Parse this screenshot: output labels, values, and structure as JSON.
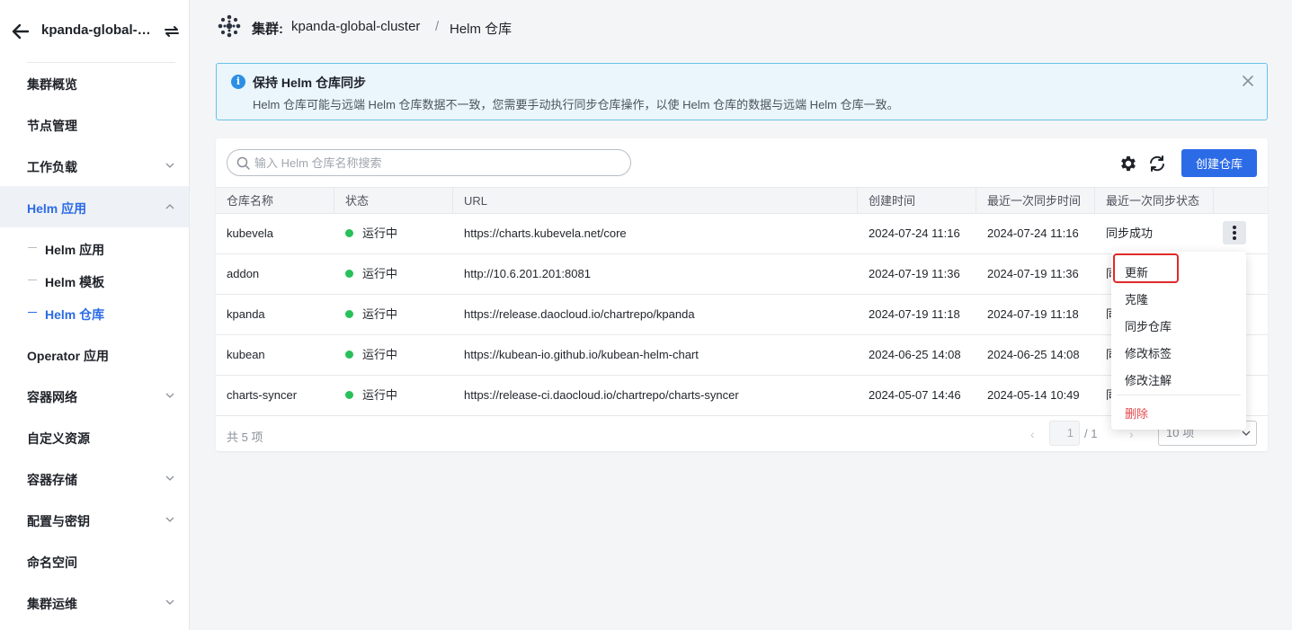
{
  "sidebar": {
    "title": "kpanda-global-cluster",
    "items": [
      {
        "label": "集群概览"
      },
      {
        "label": "节点管理"
      },
      {
        "label": "工作负载"
      },
      {
        "label": "Helm 应用"
      },
      {
        "label": "Operator 应用"
      },
      {
        "label": "容器网络"
      },
      {
        "label": "自定义资源"
      },
      {
        "label": "容器存储"
      },
      {
        "label": "配置与密钥"
      },
      {
        "label": "命名空间"
      },
      {
        "label": "集群运维"
      }
    ],
    "sub_items": [
      {
        "label": "Helm 应用"
      },
      {
        "label": "Helm 模板"
      },
      {
        "label": "Helm 仓库"
      }
    ]
  },
  "breadcrumb": {
    "cluster_label": "集群:",
    "cluster_name": "kpanda-global-cluster",
    "separator": "/",
    "current": "Helm 仓库"
  },
  "alert": {
    "title": "保持 Helm 仓库同步",
    "text": "Helm 仓库可能与远端 Helm 仓库数据不一致，您需要手动执行同步仓库操作，以使 Helm 仓库的数据与远端 Helm 仓库一致。"
  },
  "toolbar": {
    "search_placeholder": "输入 Helm 仓库名称搜索",
    "create_label": "创建仓库"
  },
  "table": {
    "headers": [
      "仓库名称",
      "状态",
      "URL",
      "创建时间",
      "最近一次同步时间",
      "最近一次同步状态"
    ],
    "rows": [
      {
        "name": "kubevela",
        "status": "运行中",
        "url": "https://charts.kubevela.net/core",
        "created": "2024-07-24 11:16",
        "synced": "2024-07-24 11:16",
        "sync_status": "同步成功"
      },
      {
        "name": "addon",
        "status": "运行中",
        "url": "http://10.6.201.201:8081",
        "created": "2024-07-19 11:36",
        "synced": "2024-07-19 11:36",
        "sync_status": "同"
      },
      {
        "name": "kpanda",
        "status": "运行中",
        "url": "https://release.daocloud.io/chartrepo/kpanda",
        "created": "2024-07-19 11:18",
        "synced": "2024-07-19 11:18",
        "sync_status": "同"
      },
      {
        "name": "kubean",
        "status": "运行中",
        "url": "https://kubean-io.github.io/kubean-helm-chart",
        "created": "2024-06-25 14:08",
        "synced": "2024-06-25 14:08",
        "sync_status": "同"
      },
      {
        "name": "charts-syncer",
        "status": "运行中",
        "url": "https://release-ci.daocloud.io/chartrepo/charts-syncer",
        "created": "2024-05-07 14:46",
        "synced": "2024-05-14 10:49",
        "sync_status": "同"
      }
    ]
  },
  "footer": {
    "count": "共 5 项",
    "page_current": "1",
    "page_total": "/ 1",
    "page_size": "10 项"
  },
  "menu": {
    "items": [
      "更新",
      "克隆",
      "同步仓库",
      "修改标签",
      "修改注解"
    ],
    "danger_item": "删除"
  },
  "colors": {
    "primary": "#2c6be6",
    "running": "#28c05a",
    "danger": "#e5484d",
    "highlight": "#e02a2a"
  }
}
